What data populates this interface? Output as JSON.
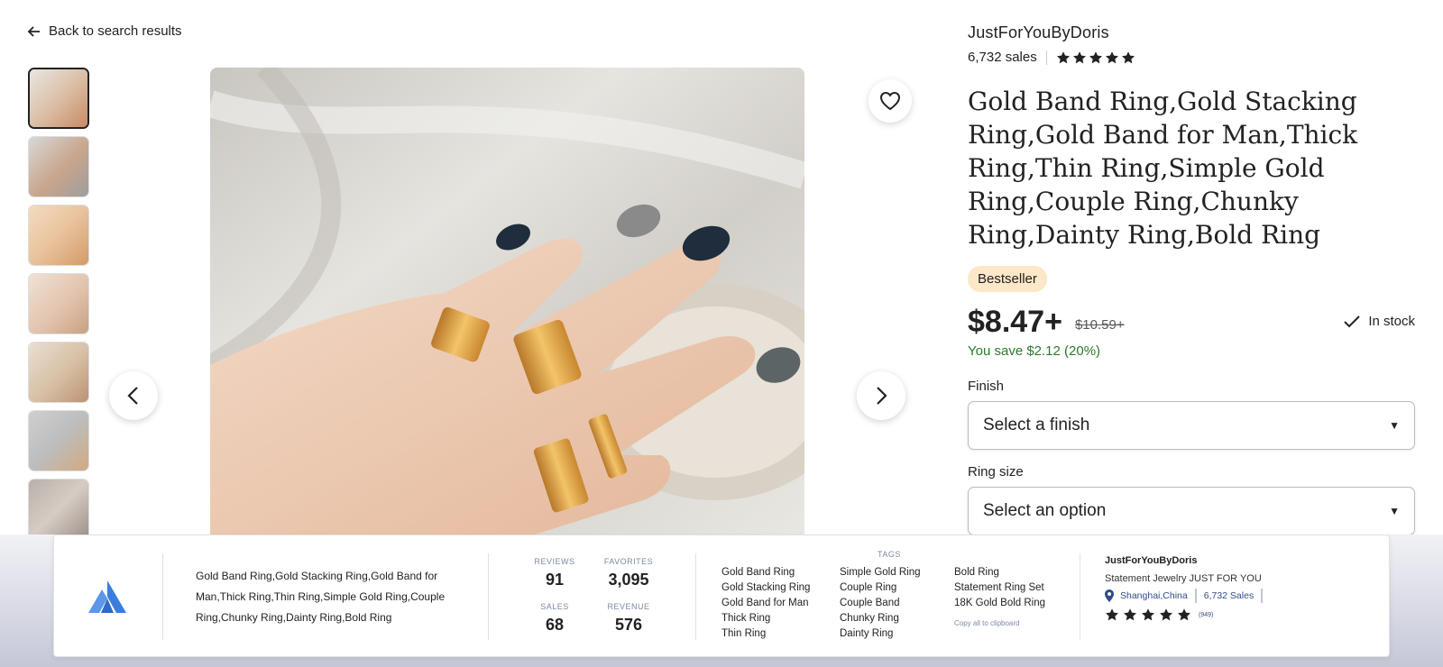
{
  "nav": {
    "back_label": "Back to search results"
  },
  "gallery": {
    "thumbnail_count": 7,
    "active_index": 0
  },
  "shop": {
    "name": "JustForYouByDoris",
    "sales": "6,732 sales",
    "rating_stars": 5
  },
  "listing": {
    "title": "Gold Band Ring,Gold Stacking Ring,Gold Band for Man,Thick Ring,Thin Ring,Simple Gold Ring,Couple Ring,Chunky Ring,Dainty Ring,Bold Ring",
    "badge": "Bestseller",
    "price": "$8.47+",
    "original_price": "$10.59+",
    "savings": "You save $2.12 (20%)",
    "stock": "In stock"
  },
  "options": {
    "finish_label": "Finish",
    "finish_value": "Select a finish",
    "size_label": "Ring size",
    "size_value": "Select an option"
  },
  "panel": {
    "title": "Gold Band Ring,Gold Stacking Ring,Gold Band for Man,Thick Ring,Thin Ring,Simple Gold Ring,Couple Ring,Chunky Ring,Dainty Ring,Bold Ring",
    "stats": {
      "reviews_label": "REVIEWS",
      "reviews": "91",
      "favorites_label": "FAVORITES",
      "favorites": "3,095",
      "sales_label": "SALES",
      "sales": "68",
      "revenue_label": "REVENUE",
      "revenue": "576"
    },
    "tags_label": "TAGS",
    "tags_col1": [
      "Gold Band Ring",
      "Gold Stacking Ring",
      "Gold Band for Man",
      "Thick Ring",
      "Thin Ring"
    ],
    "tags_col2": [
      "Simple Gold Ring",
      "Couple Ring",
      "Couple Band",
      "Chunky Ring",
      "Dainty Ring"
    ],
    "tags_col3": [
      "Bold Ring",
      "Statement Ring Set",
      "18K Gold Bold Ring"
    ],
    "copy_label": "Copy all to clipboard",
    "seller": {
      "name": "JustForYouByDoris",
      "tagline": "Statement Jewelry JUST FOR YOU",
      "location": "Shanghai,China",
      "sales": "6,732 Sales",
      "rating_stars": 5,
      "rating_count": "(949)"
    }
  },
  "colors": {
    "text": "#222222",
    "badge_bg": "#fde7c9",
    "savings_green": "#2b7a2b",
    "logo_blue": "#3b7ddd",
    "link_blue": "#2e4e8a"
  },
  "icons": [
    "arrow-left-icon",
    "heart-icon",
    "chevron-left-icon",
    "chevron-right-icon",
    "star-icon",
    "check-icon",
    "caret-down-icon",
    "location-pin-icon",
    "app-logo-icon"
  ]
}
